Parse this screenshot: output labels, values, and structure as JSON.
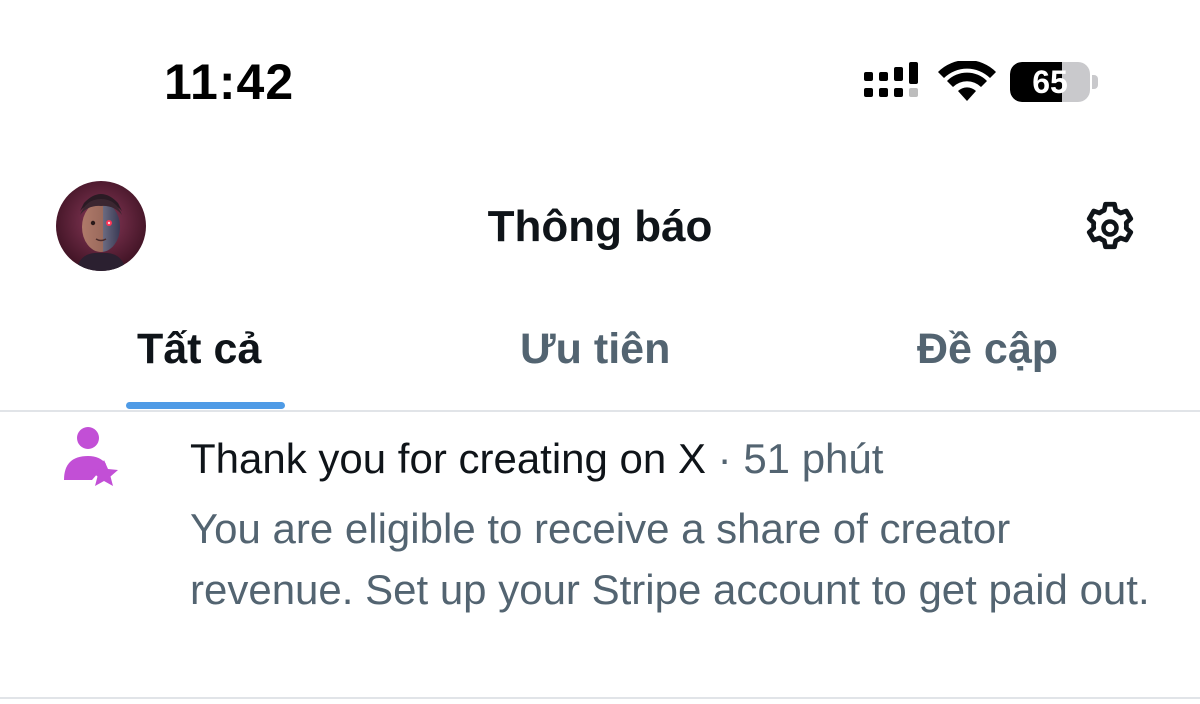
{
  "status_bar": {
    "time": "11:42",
    "battery_level": "65",
    "battery_fraction": 0.65,
    "icons": [
      "signal-bars-icon",
      "wifi-icon",
      "battery-icon"
    ]
  },
  "header": {
    "title": "Thông báo",
    "avatar_icon": "avatar",
    "settings_icon": "gear-icon"
  },
  "tabs": [
    {
      "label": "Tất cả",
      "active": true
    },
    {
      "label": "Ưu tiên",
      "active": false
    },
    {
      "label": "Đề cập",
      "active": false
    }
  ],
  "notifications": [
    {
      "icon": "person-star-icon",
      "title": "Thank you for creating on X",
      "separator": "·",
      "time": "51 phút",
      "body": "You are eligible to receive a share of creator revenue. Set up your Stripe account to get paid out."
    }
  ],
  "colors": {
    "accent": "#4f9be6",
    "text_primary": "#0f1419",
    "text_secondary": "#536471",
    "notif_icon": "#c24fd6",
    "divider": "#e1e4e8"
  }
}
